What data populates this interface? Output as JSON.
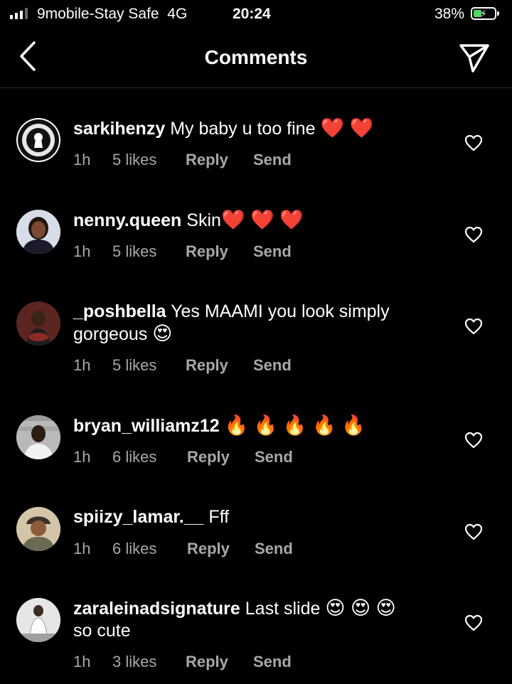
{
  "status_bar": {
    "carrier": "9mobile-Stay Safe",
    "network": "4G",
    "time": "20:24",
    "battery": "38%",
    "battery_level": 0.38,
    "charging": true
  },
  "header": {
    "title": "Comments",
    "back_icon": "chevron-left-icon",
    "share_icon": "paper-plane-icon"
  },
  "colors": {
    "background": "#000000",
    "text": "#ffffff",
    "muted": "#a8a8a8",
    "battery": "#4cd964",
    "divider": "#262626"
  },
  "comments": [
    {
      "username": "sarkihenzy",
      "text": "My baby u too fine",
      "emoji": "❤️ ❤️",
      "time": "1h",
      "likes": "5 likes",
      "reply": "Reply",
      "send": "Send"
    },
    {
      "username": "nenny.queen",
      "text": "Skin",
      "emoji": "❤️ ❤️ ❤️",
      "time": "1h",
      "likes": "5 likes",
      "reply": "Reply",
      "send": "Send"
    },
    {
      "username": "_poshbella",
      "text": "Yes MAAMI you look simply gorgeous",
      "emoji": "😍",
      "time": "1h",
      "likes": "5 likes",
      "reply": "Reply",
      "send": "Send"
    },
    {
      "username": "bryan_williamz12",
      "text": "",
      "emoji": "🔥 🔥 🔥 🔥 🔥",
      "time": "1h",
      "likes": "6 likes",
      "reply": "Reply",
      "send": "Send"
    },
    {
      "username": "spiizy_lamar.__",
      "text": "Fff",
      "emoji": "",
      "time": "1h",
      "likes": "6 likes",
      "reply": "Reply",
      "send": "Send"
    },
    {
      "username": "zaraleinadsignature",
      "text": "Last slide",
      "emoji": "😍 😍 😍",
      "text2": "so cute",
      "time": "1h",
      "likes": "3 likes",
      "reply": "Reply",
      "send": "Send"
    }
  ]
}
